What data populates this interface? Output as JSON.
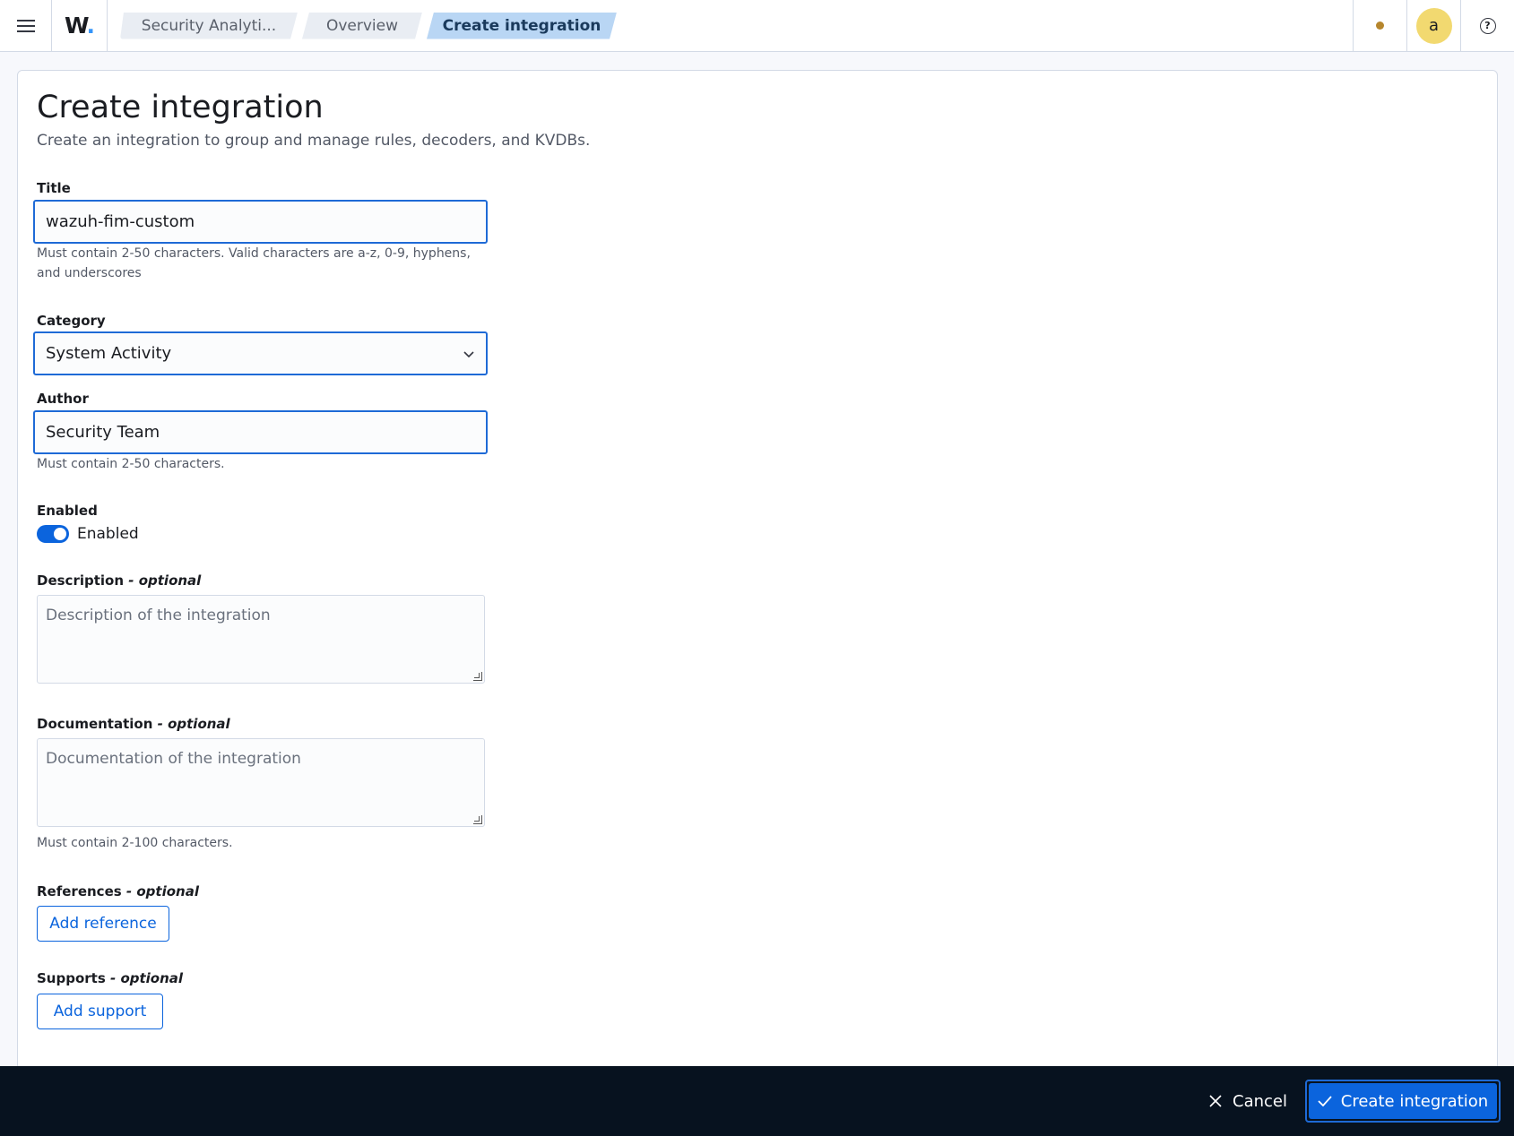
{
  "topbar": {
    "logo": "W",
    "breadcrumbs": [
      "Security Analyti...",
      "Overview",
      "Create integration"
    ],
    "avatar_letter": "a",
    "help_glyph": "?"
  },
  "page": {
    "title": "Create integration",
    "subtitle": "Create an integration to group and manage rules, decoders, and KVDBs."
  },
  "form": {
    "title": {
      "label": "Title",
      "value": "wazuh-fim-custom",
      "help": "Must contain 2-50 characters. Valid characters are a-z, 0-9, hyphens, and underscores"
    },
    "category": {
      "label": "Category",
      "value": "System Activity"
    },
    "author": {
      "label": "Author",
      "value": "Security Team",
      "help": "Must contain 2-50 characters."
    },
    "enabled": {
      "label": "Enabled",
      "toggle_label": "Enabled",
      "state": true
    },
    "description": {
      "label": "Description",
      "optional": "- optional",
      "placeholder": "Description of the integration"
    },
    "documentation": {
      "label": "Documentation",
      "optional": "- optional",
      "placeholder": "Documentation of the integration",
      "help": "Must contain 2-100 characters."
    },
    "references": {
      "label": "References",
      "optional": "- optional",
      "button": "Add reference"
    },
    "supports": {
      "label": "Supports",
      "optional": "- optional",
      "button": "Add support"
    }
  },
  "footer": {
    "cancel": "Cancel",
    "submit": "Create integration"
  },
  "colors": {
    "accent": "#0b64dd",
    "footer_bg": "#07121f",
    "avatar_bg": "#f2d970",
    "status_dot": "#b6862d"
  }
}
